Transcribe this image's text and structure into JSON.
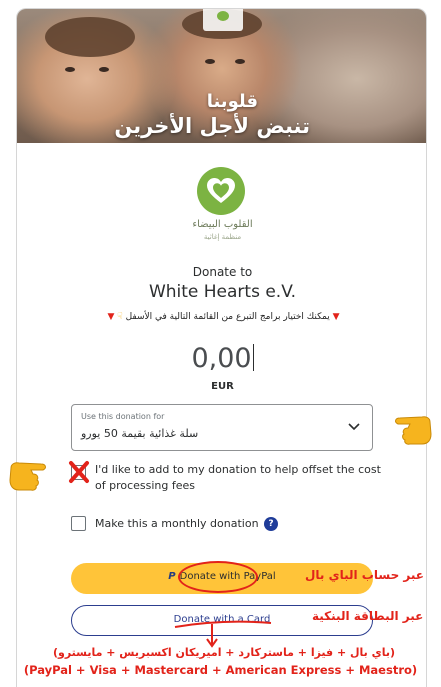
{
  "banner": {
    "line1": "قلوبنا",
    "line2": "تنبض لأجل الأخرين"
  },
  "org": {
    "name_ar": "القلوب البيضاء",
    "sub_ar": "منظمة إغاثية",
    "donate_to": "Donate to",
    "title": "White Hearts e.V."
  },
  "note": {
    "text": "يمكنك اختيار برامج التبرع من القائمة التالية في الأسفل"
  },
  "amount": {
    "value": "0,00",
    "currency": "EUR"
  },
  "designation": {
    "label": "Use this donation for",
    "value": "سلة غذائية بقيمة 50 يورو"
  },
  "options": {
    "fee_label": "I'd like to add to my donation to help offset the cost of processing fees",
    "monthly_label": "Make this a monthly donation",
    "help": "?"
  },
  "buttons": {
    "paypal_label": "Donate with PayPal",
    "paypal_mark": "P",
    "card_label": "Donate with a Card"
  },
  "annotations": {
    "paypal_ar": "عبر حساب الباي بال",
    "card_ar": "عبر البطاقة البنكية",
    "methods_ar": "(باي بال + فيزا + ماستركارد + اميريكان اكسبريس + مايسترو)",
    "methods_en": "(PayPal + Visa + Mastercard + American Express + Maestro)"
  },
  "colors": {
    "paypal_yellow": "#ffc439",
    "brand_green": "#7cb342",
    "annotation_red": "#e2231a",
    "card_blue": "#2c3e8f"
  }
}
